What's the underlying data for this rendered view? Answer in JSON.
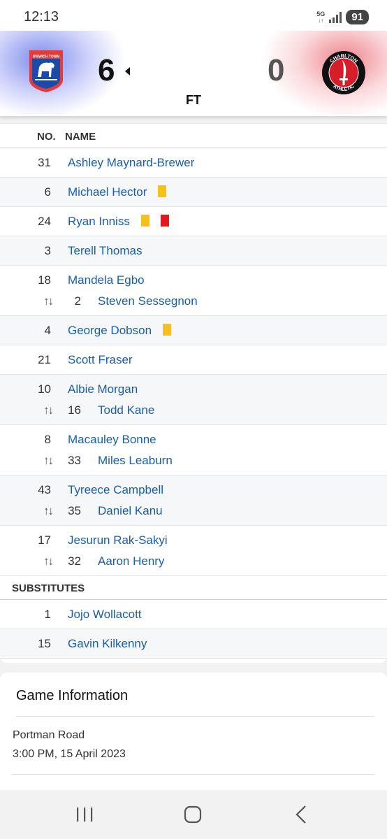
{
  "status_bar": {
    "time": "12:13",
    "network": "5G",
    "battery": "91",
    "icons": [
      "5g-icon",
      "signal-icon",
      "battery-icon"
    ]
  },
  "scoreboard": {
    "home_score": "6",
    "away_score": "0",
    "status": "FT",
    "home_crest": {
      "icon": "ipswich-town-crest",
      "text": "IPSWICH TOWN",
      "color": "#1b4aa8"
    },
    "away_crest": {
      "icon": "charlton-athletic-crest",
      "text_top": "CHARLTON",
      "text_bottom": "ATHLETIC",
      "color": "#d61e2a"
    }
  },
  "lineup": {
    "col_no": "NO.",
    "col_name": "NAME",
    "starters": [
      {
        "no": "31",
        "name": "Ashley Maynard-Brewer",
        "cards": []
      },
      {
        "no": "6",
        "name": "Michael Hector",
        "cards": [
          "yellow"
        ]
      },
      {
        "no": "24",
        "name": "Ryan Inniss",
        "cards": [
          "yellow",
          "red"
        ]
      },
      {
        "no": "3",
        "name": "Terell Thomas",
        "cards": []
      },
      {
        "no": "18",
        "name": "Mandela Egbo",
        "cards": [],
        "sub": {
          "no": "2",
          "name": "Steven Sessegnon"
        }
      },
      {
        "no": "4",
        "name": "George Dobson",
        "cards": [
          "yellow"
        ]
      },
      {
        "no": "21",
        "name": "Scott Fraser",
        "cards": []
      },
      {
        "no": "10",
        "name": "Albie Morgan",
        "cards": [],
        "sub": {
          "no": "16",
          "name": "Todd Kane"
        }
      },
      {
        "no": "8",
        "name": "Macauley Bonne",
        "cards": [],
        "sub": {
          "no": "33",
          "name": "Miles Leaburn"
        }
      },
      {
        "no": "43",
        "name": "Tyreece Campbell",
        "cards": [],
        "sub": {
          "no": "35",
          "name": "Daniel Kanu"
        }
      },
      {
        "no": "17",
        "name": "Jesurun Rak-Sakyi",
        "cards": [],
        "sub": {
          "no": "32",
          "name": "Aaron Henry"
        }
      }
    ],
    "substitutes_title": "SUBSTITUTES",
    "substitutes": [
      {
        "no": "1",
        "name": "Jojo Wollacott"
      },
      {
        "no": "15",
        "name": "Gavin Kilkenny"
      }
    ],
    "sub_icon": "⮁",
    "colors": {
      "yellow_card": "#f4c21b",
      "red_card": "#e01b1b",
      "link": "#1a5ea8"
    }
  },
  "game_info": {
    "title": "Game Information",
    "venue": "Portman Road",
    "datetime": "3:00 PM, 15 April 2023"
  },
  "nav": [
    "recent-apps-icon",
    "home-icon",
    "back-icon"
  ]
}
